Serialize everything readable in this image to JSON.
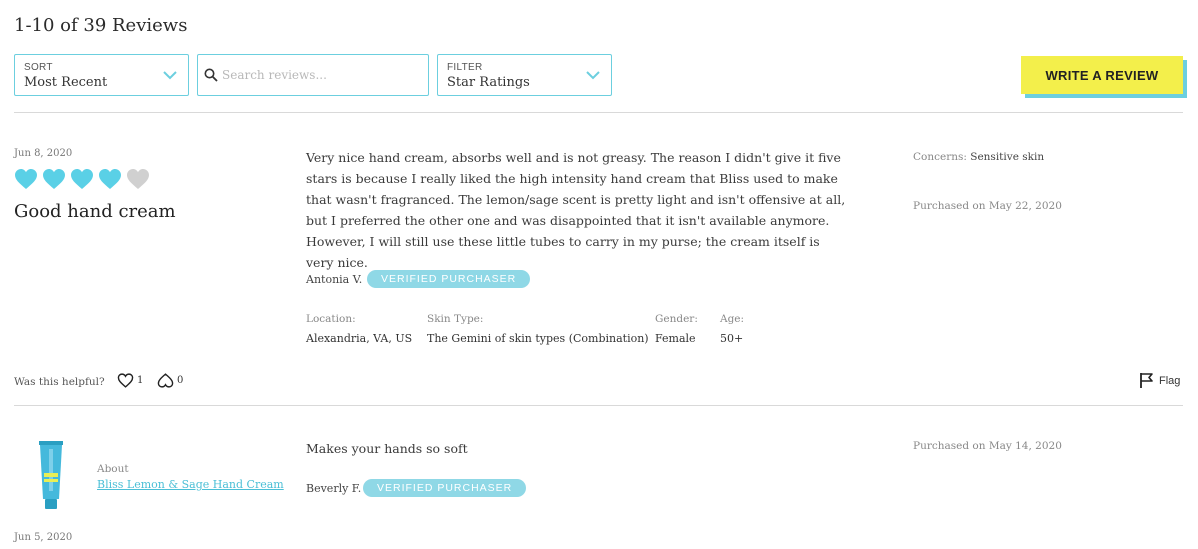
{
  "header": {
    "title": "1-10 of 39 Reviews"
  },
  "controls": {
    "sort": {
      "label": "SORT",
      "value": "Most Recent"
    },
    "search": {
      "placeholder": "Search reviews..."
    },
    "filter": {
      "label": "FILTER",
      "value": "Star Ratings"
    },
    "write_review": "WRITE A REVIEW"
  },
  "colors": {
    "accent": "#6ccfdf",
    "heart_filled": "#5ad0e6",
    "heart_empty": "#d0d0d0",
    "button_bg": "#f3ef4b",
    "badge_bg": "#8fd8e6"
  },
  "reviews": [
    {
      "date": "Jun 8, 2020",
      "rating": 4,
      "max_rating": 5,
      "title": "Good hand cream",
      "body": "Very nice hand cream, absorbs well and is not greasy. The reason I didn't give it five stars is because I really liked the high intensity hand cream that Bliss used to make that wasn't fragranced. The lemon/sage scent is pretty light and isn't offensive at all, but I preferred the other one and was disappointed that it isn't available anymore. However, I will still use these little tubes to carry in my purse; the cream itself is very nice.",
      "reviewer": "Antonia V.",
      "badge": "VERIFIED PURCHASER",
      "attributes": [
        {
          "label": "Location:",
          "value": "Alexandria, VA, US"
        },
        {
          "label": "Skin Type:",
          "value": "The Gemini of skin types (Combination)"
        },
        {
          "label": "Gender:",
          "value": "Female"
        },
        {
          "label": "Age:",
          "value": "50+"
        }
      ],
      "concerns_label": "Concerns:",
      "concerns_value": "Sensitive skin",
      "purchased": "Purchased on May 22, 2020",
      "helpful_label": "Was this helpful?",
      "helpful_yes": "1",
      "helpful_no": "0",
      "flag": "Flag"
    },
    {
      "about_label": "About",
      "product_link": "Bliss Lemon & Sage Hand Cream",
      "body": "Makes your hands so soft",
      "reviewer": "Beverly F.",
      "badge": "VERIFIED PURCHASER",
      "purchased": "Purchased on May 14, 2020",
      "date": "Jun 5, 2020"
    }
  ]
}
